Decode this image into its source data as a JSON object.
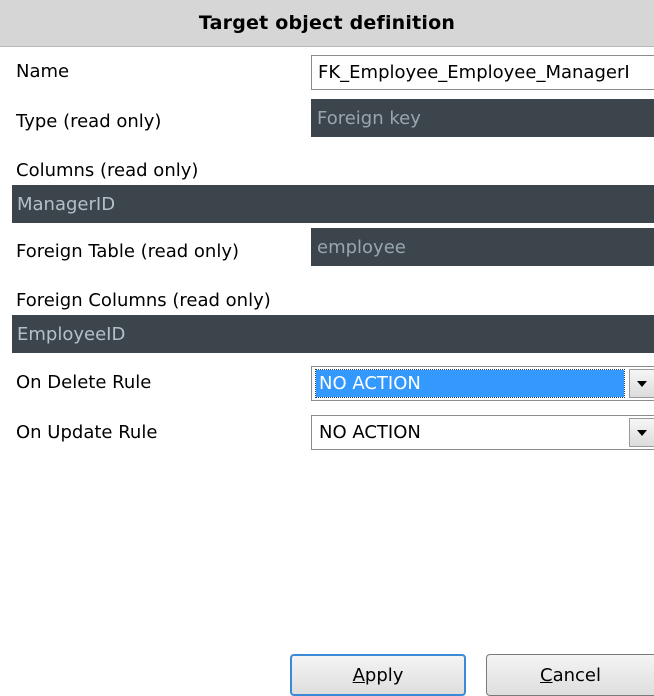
{
  "header": {
    "title": "Target object definition"
  },
  "fields": {
    "name": {
      "label": "Name",
      "value": "FK_Employee_Employee_ManagerI"
    },
    "type": {
      "label": "Type (read only)",
      "value": "Foreign key"
    },
    "columns": {
      "label": "Columns (read only)",
      "value": "ManagerID"
    },
    "foreign_table": {
      "label": "Foreign Table (read only)",
      "value": "employee"
    },
    "foreign_columns": {
      "label": "Foreign Columns (read only)",
      "value": "EmployeeID"
    },
    "on_delete": {
      "label": "On Delete Rule",
      "value": "NO ACTION"
    },
    "on_update": {
      "label": "On Update Rule",
      "value": "NO ACTION"
    }
  },
  "buttons": {
    "apply": {
      "mnemonic": "A",
      "rest": "pply"
    },
    "cancel": {
      "mnemonic": "C",
      "rest": "ancel"
    }
  },
  "icons": {
    "combo_arrow": "chevron-down-icon"
  },
  "colors": {
    "readonly_bg": "#3c454b",
    "selection": "#3399ff",
    "header_bg": "#d6d6d6"
  }
}
